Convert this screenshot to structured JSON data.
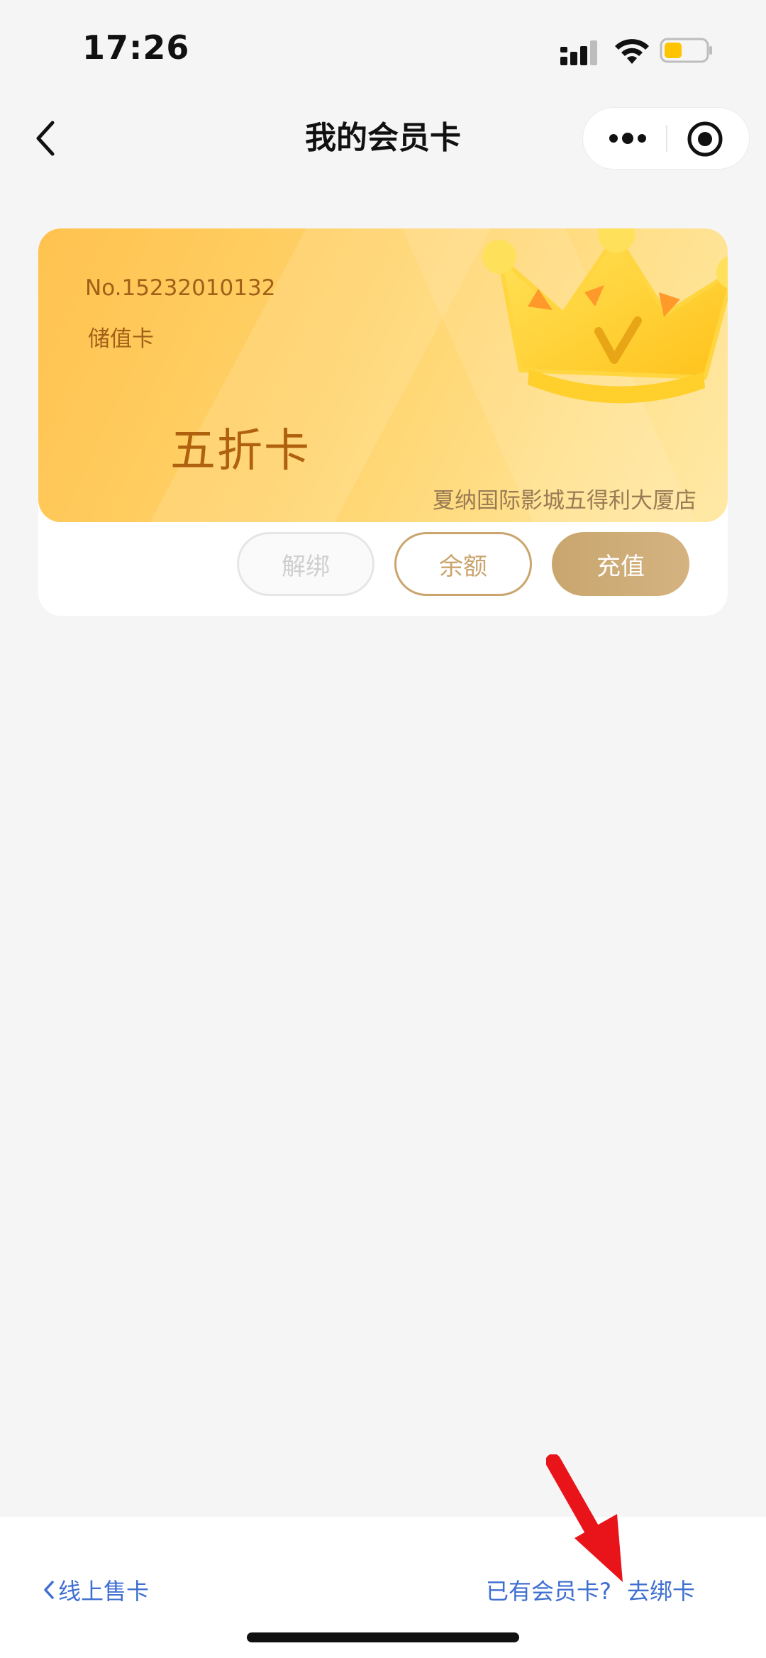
{
  "status_bar": {
    "time": "17:26",
    "battery_color": "#ffc400"
  },
  "nav": {
    "title": "我的会员卡",
    "back_icon": "chevron-left-icon",
    "more_icon": "more-dots-icon",
    "close_icon": "target-close-icon"
  },
  "card": {
    "number": "No.15232010132",
    "type": "储值卡",
    "name": "五折卡",
    "store": "夏纳国际影城五得利大厦店",
    "colors": {
      "gold_light": "#ffe08c",
      "gold": "#ffc24f",
      "text": "#b0610e"
    }
  },
  "actions": {
    "unbind": "解绑",
    "balance": "余额",
    "recharge": "充值"
  },
  "bottom": {
    "online_sale": "线上售卡",
    "have_card": "已有会员卡?",
    "go_bind": "去绑卡"
  },
  "annotation": {
    "arrow_color": "#e8141a"
  }
}
